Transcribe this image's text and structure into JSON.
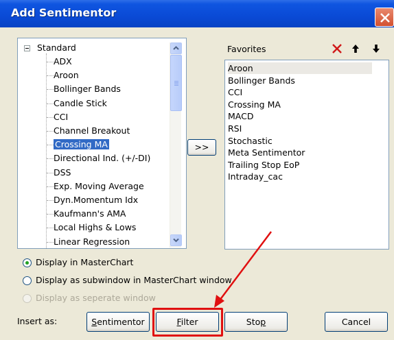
{
  "window": {
    "title": "Add Sentimentor"
  },
  "tree": {
    "root_label": "Standard",
    "items": [
      "ADX",
      "Aroon",
      "Bollinger Bands",
      "Candle Stick",
      "CCI",
      "Channel Breakout",
      "Crossing MA",
      "Directional Ind. (+/-DI)",
      "DSS",
      "Exp. Moving Average",
      "Dyn.Momentum Idx",
      "Kaufmann's AMA",
      "Local Highs & Lows",
      "Linear Regression"
    ],
    "selected": "Crossing MA"
  },
  "add_button_label": ">>",
  "favorites": {
    "header": "Favorites",
    "items": [
      "Aroon",
      "Bollinger Bands",
      "CCI",
      "Crossing MA",
      "MACD",
      "RSI",
      "Stochastic",
      "Meta Sentimentor",
      "Trailing Stop EoP",
      "Intraday_cac"
    ],
    "highlighted": "Aroon"
  },
  "options": [
    {
      "label": "Display in MasterChart",
      "checked": true,
      "enabled": true
    },
    {
      "label": "Display as subwindow in MasterChart window",
      "checked": false,
      "enabled": true
    },
    {
      "label": "Display as seperate window",
      "checked": false,
      "enabled": false
    }
  ],
  "insert_as_label": "Insert as:",
  "buttons": {
    "sentimentor": {
      "pre": "",
      "u": "S",
      "post": "entimentor"
    },
    "filter": {
      "pre": "",
      "u": "F",
      "post": "ilter"
    },
    "stop": {
      "pre": "Sto",
      "u": "p",
      "post": ""
    },
    "cancel": "Cancel"
  },
  "annotation": {
    "color": "#E01010"
  }
}
